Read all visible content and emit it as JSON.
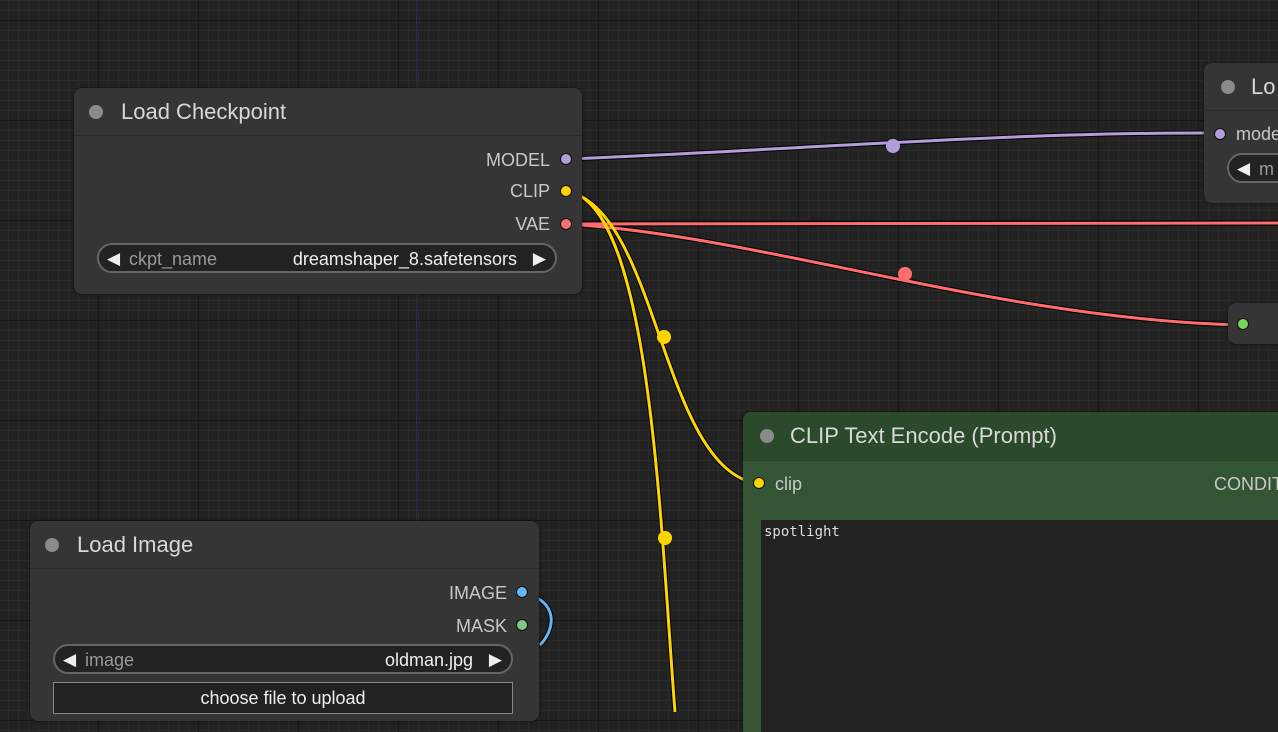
{
  "colors": {
    "model": "#b39ddb",
    "clip": "#ffd500",
    "vae": "#ff6e6e",
    "image": "#64b5f6",
    "mask": "#81c784",
    "green_slot": "#7ad65a",
    "clip_node_bg": "#335533"
  },
  "load_checkpoint": {
    "title": "Load Checkpoint",
    "outputs": [
      "MODEL",
      "CLIP",
      "VAE"
    ],
    "widget": {
      "name": "ckpt_name",
      "value": "dreamshaper_8.safetensors"
    }
  },
  "load_image": {
    "title": "Load Image",
    "outputs": [
      "IMAGE",
      "MASK"
    ],
    "widget": {
      "name": "image",
      "value": "oldman.jpg"
    },
    "upload_label": "choose file to upload"
  },
  "clip_text_encode": {
    "title": "CLIP Text Encode (Prompt)",
    "input": "clip",
    "output": "CONDIT",
    "text": "spotlight"
  },
  "right_node": {
    "title": "Lo",
    "input": "mode",
    "widget_text": "m"
  }
}
